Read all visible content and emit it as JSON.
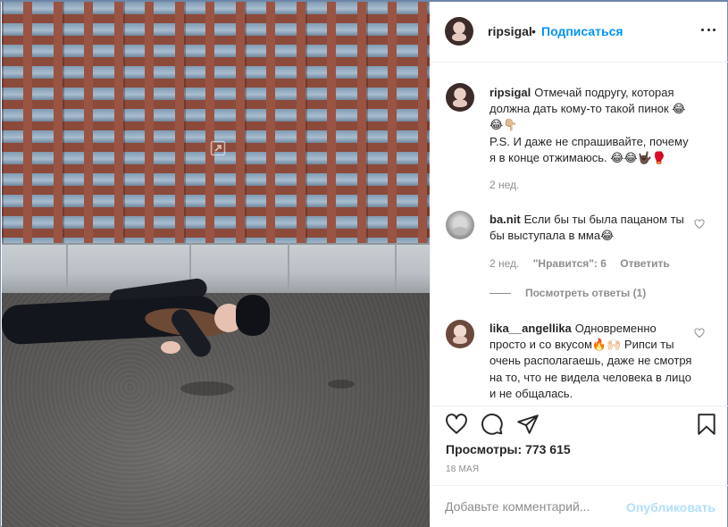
{
  "post": {
    "author": "ripsigal",
    "separator": "•",
    "follow_label": "Подписаться",
    "caption_line1": "Отмечай подругу, которая должна дать кому-то такой пинок 😂😂👇🏼",
    "caption_line2": "P.S. И даже не спрашивайте, почему я в конце отжимаюсь. 😂😂🤟🏿🥊",
    "caption_age": "2 нед."
  },
  "comments": [
    {
      "username": "ba.nit",
      "text": "Если бы ты была пацаном ты бы выступала в мма😂",
      "age": "2 нед.",
      "likes": "\"Нравится\": 6",
      "reply_label": "Ответить",
      "view_replies": "Посмотреть ответы (1)"
    },
    {
      "username": "lika__angellika",
      "text": "Одновременно просто и со вкусом🔥🙌🏻 Рипси ты очень располагаешь, даже не смотря на то, что не видела человека в лицо и не общалась."
    }
  ],
  "stats": {
    "views_label": "Просмотры:",
    "views_value": "773 615",
    "date": "18 МАЯ"
  },
  "add_comment": {
    "placeholder": "Добавьте комментарий...",
    "publish_label": "Опубликовать"
  },
  "icons": {
    "like": "heart-icon",
    "comment": "comment-icon",
    "share": "paper-plane-icon",
    "save": "bookmark-icon",
    "more": "more-dots-icon",
    "expand": "expand-icon"
  },
  "colors": {
    "link_blue": "#0095f6",
    "publish_disabled": "#b2dffc",
    "muted": "#8e8e8e",
    "text": "#262626"
  }
}
